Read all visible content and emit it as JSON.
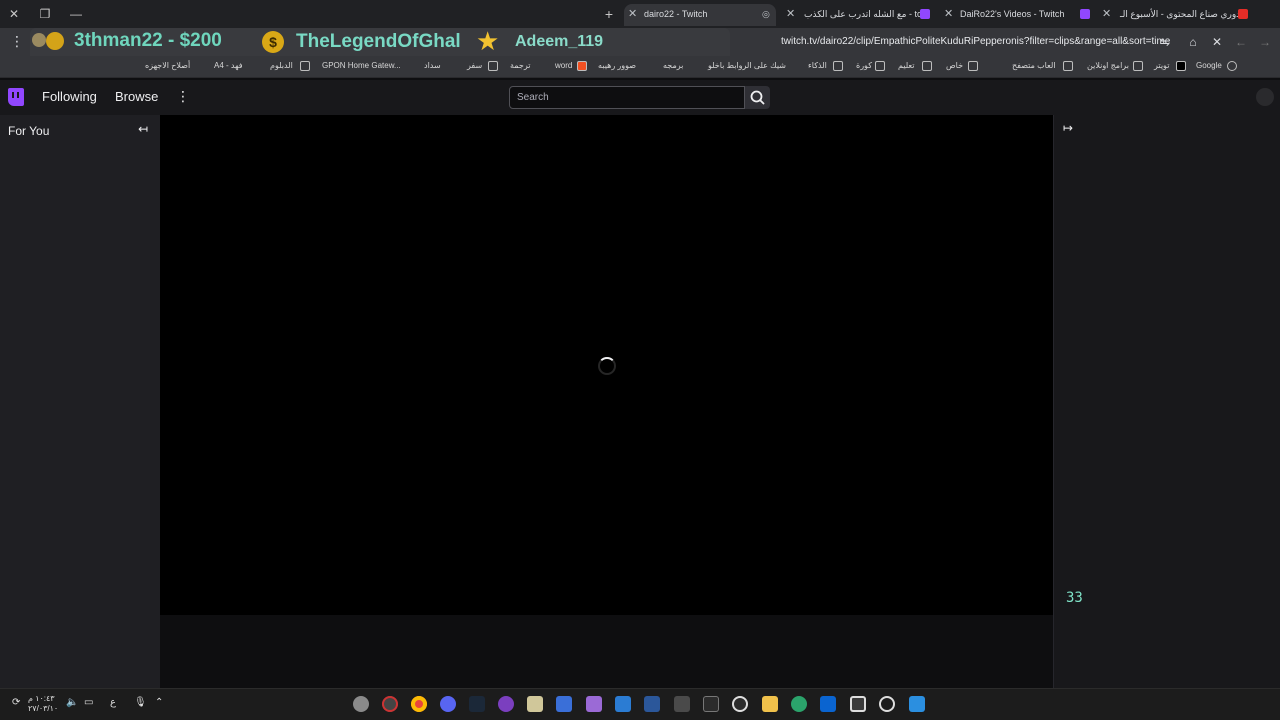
{
  "browser": {
    "tabs": [
      {
        "title": "dairo22 - Twitch",
        "active": true
      },
      {
        "title": "مع الشله اتدرب على الكذب - tch",
        "active": false
      },
      {
        "title": "DaiRo22's Videos - Twitch",
        "active": false
      },
      {
        "title": "دوري صناع المحتوى - الأسبوع الـ",
        "active": false
      }
    ],
    "new_tab_label": "+",
    "url": "twitch.tv/dairo22/clip/EmpathicPoliteKuduRiPepperonis?filter=clips&range=all&sort=time",
    "bookmarks": [
      "Google",
      "تويتر",
      "برامج اونلاين",
      "العاب متصفح",
      "خاص",
      "تعليم",
      "كورة",
      "الذكاء",
      "شيك على الروابط باخلو",
      "برمجه",
      "صوور رهيبه",
      "word",
      "ترجمة",
      "سفر",
      "سداد",
      "GPON Home Gatew...",
      "الدبلوم",
      "فهد - A4",
      "أصلاح الاجهزه"
    ]
  },
  "overlay": {
    "donation": "3thman22 - $200",
    "dollar_symbol": "$",
    "name2": "TheLegendOfGhal",
    "name3": "Adeem_119"
  },
  "twitch": {
    "nav": {
      "following": "Following",
      "browse": "Browse"
    },
    "search_placeholder": "Search",
    "sidebar_title": "For You",
    "side_counter": "33"
  },
  "taskbar": {
    "clock_time": "١٠:٤٣ م",
    "clock_date": "٢٧/٠٣/١٠",
    "lang": "ع"
  },
  "colors": {
    "twitch_purple": "#9147ff",
    "overlay_text": "#79d9c4",
    "coin_gold": "#d9a816"
  }
}
